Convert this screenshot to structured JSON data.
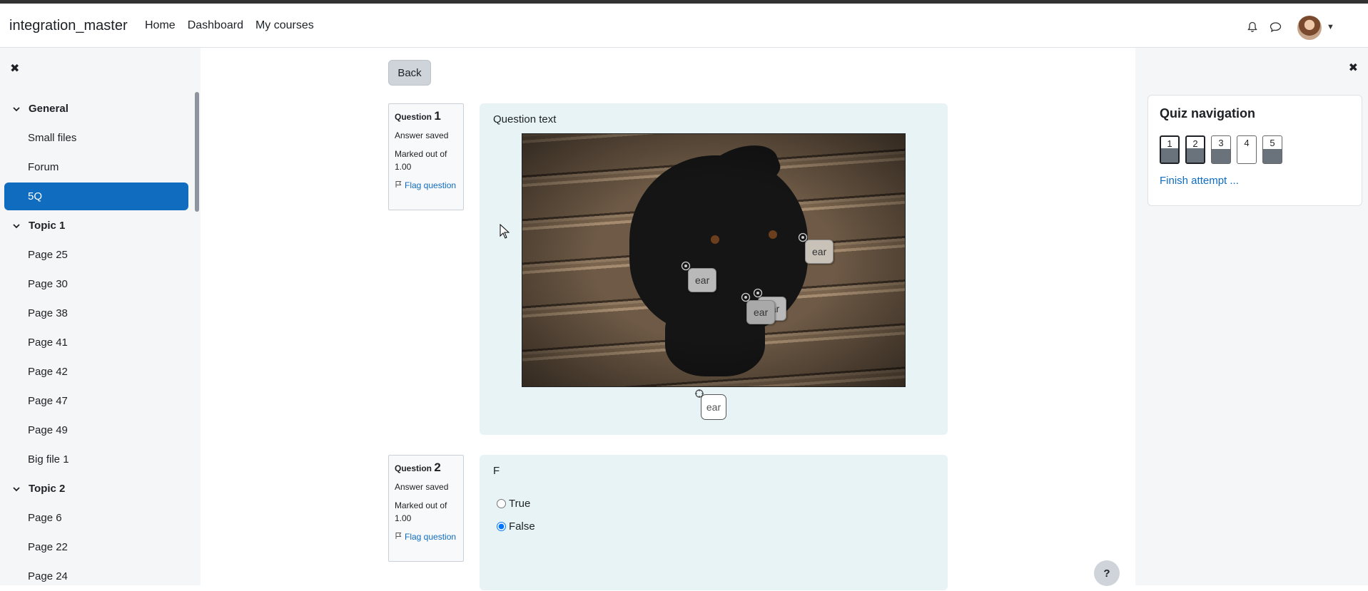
{
  "navbar": {
    "brand": "integration_master",
    "links": [
      "Home",
      "Dashboard",
      "My courses"
    ]
  },
  "course_index": {
    "sections": [
      {
        "title": "General",
        "items": [
          "Small files",
          "Forum",
          "5Q"
        ]
      },
      {
        "title": "Topic 1",
        "items": [
          "Page 25",
          "Page 30",
          "Page 38",
          "Page 41",
          "Page 42",
          "Page 47",
          "Page 49",
          "Big file 1"
        ]
      },
      {
        "title": "Topic 2",
        "items": [
          "Page 6",
          "Page 22",
          "Page 24"
        ]
      }
    ],
    "active_item": "5Q"
  },
  "main": {
    "back_label": "Back",
    "question1": {
      "label": "Question",
      "number": "1",
      "state": "Answer saved",
      "grade": "Marked out of 1.00",
      "flag_label": "Flag question",
      "text": "Question text",
      "drag_item": "ear",
      "placed_labels": [
        "ear",
        "ear",
        "ear",
        "ear"
      ]
    },
    "question2": {
      "label": "Question",
      "number": "2",
      "state": "Answer saved",
      "grade": "Marked out of 1.00",
      "flag_label": "Flag question",
      "text": "F",
      "options": [
        "True",
        "False"
      ],
      "selected": "False"
    }
  },
  "quiz_navigation": {
    "title": "Quiz navigation",
    "buttons": [
      {
        "label": "1",
        "answered": true,
        "current": true
      },
      {
        "label": "2",
        "answered": true,
        "current": true
      },
      {
        "label": "3",
        "answered": true,
        "current": false
      },
      {
        "label": "4",
        "answered": false,
        "current": false
      },
      {
        "label": "5",
        "answered": true,
        "current": false
      }
    ],
    "finish_label": "Finish attempt ..."
  },
  "help_label": "?",
  "colors": {
    "accent": "#0f6cbf",
    "drawer": "#f5f6f8",
    "question_bg": "#e7f3f5"
  }
}
